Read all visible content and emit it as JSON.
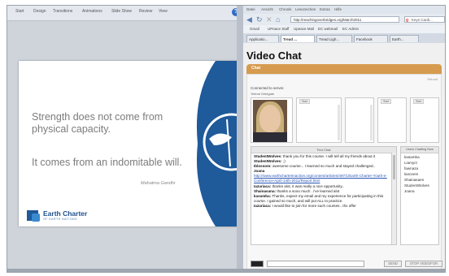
{
  "ppt": {
    "tabs": [
      "Start",
      "Design",
      "Transitions",
      "Animations",
      "Slide Show",
      "Review",
      "View"
    ],
    "help_glyph": "?"
  },
  "slide": {
    "quote_line1": "Strength does not come from",
    "quote_line2": "physical capacity.",
    "quote_line3": "It comes from an indomitable will.",
    "author": "Mahatma Gandhi",
    "logo_text": "Earth Charter",
    "logo_sub": "OF EARTH NATIONS",
    "accent": "#1f5a9a"
  },
  "browser": {
    "menu": [
      "Datei",
      "Ansicht",
      "Chronik",
      "Lesezeichen",
      "Extras",
      "Hilfe"
    ],
    "address": "http://reachingoverbridges.org/March2011",
    "search_text": "Keys Cardi...",
    "bookmarks": [
      "Gmail",
      "UPeace Staff",
      "Upeace Mail",
      "EC webmail",
      "EC Admin"
    ],
    "tabs": [
      "Applicatio...",
      "Tread ...",
      "Tread Ligh...",
      "Facebook",
      "Earth..."
    ],
    "active_tab_index": 1
  },
  "page": {
    "title": "Video Chat",
    "bar_label": "Chat",
    "reload": "Reload",
    "connected": "Connected to server.",
    "connected_sub": "Yelene    Delegate",
    "video_label": "Start",
    "text_chat_header": "Text Chat",
    "users_header": "Users Chatting Now",
    "messages": [
      {
        "name": "StudentWolves:",
        "text": " thank you for this course. I will tell all my friends about it"
      },
      {
        "name": "StudentWolves:",
        "text": " ;)"
      },
      {
        "name": "Iblossom:",
        "text": " awesome course... I learned so much and stayed challenged.."
      },
      {
        "name": "Joana",
        "text": ""
      },
      {
        "name": "",
        "text": "http://www.earthcharterinaction.org/content/articles/497/1/Earth-Charter-Youth-e-Conference-April-14th-2011/Report.html",
        "link": true
      },
      {
        "name": "Iazuriaca:",
        "text": " thanks alot, it was really a nice opportunity.."
      },
      {
        "name": "Shainasana:",
        "text": " thanks a sooo much . i've learned alot"
      },
      {
        "name": "kasamba:",
        "text": " Thanks, expect my email and my experience for participating in this course. I gained so much, and will put ALL to practice."
      },
      {
        "name": "Iazuriaca:",
        "text": " I would like to join for more such courses.. thx offer"
      }
    ],
    "users": [
      "kasamba",
      "Liamyct",
      "fawnaza",
      "lanceem",
      "Shainasaen",
      "StudentWolves",
      "Joana"
    ],
    "send_label": "SEND",
    "stop_label": "STOP VIDEOFOR"
  }
}
